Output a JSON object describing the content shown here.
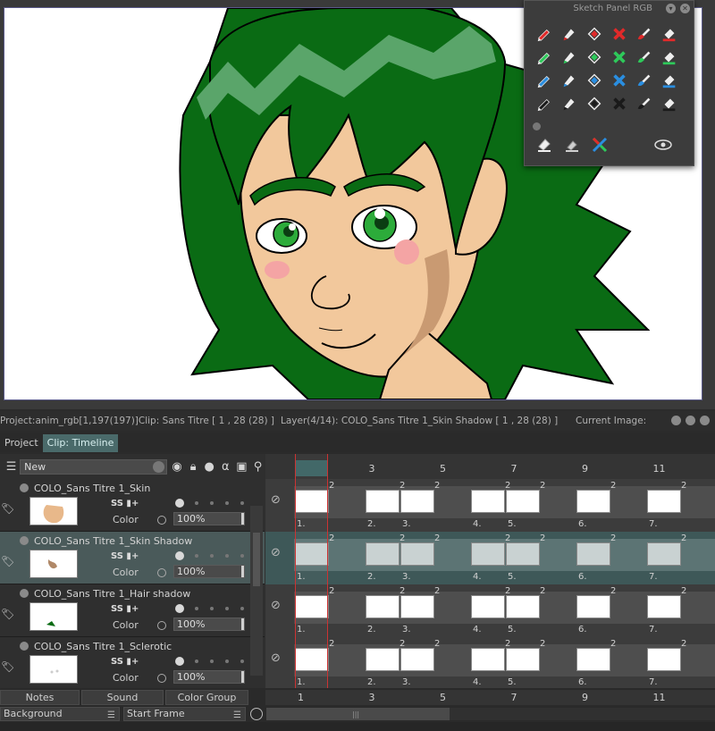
{
  "sketch_panel": {
    "title": "Sketch Panel RGB",
    "menu_glyph": "▾",
    "close_glyph": "✕",
    "colors": {
      "red": "#e02a2a",
      "green": "#2ec95a",
      "blue": "#2a8ee0",
      "black": "#1a1a1a"
    }
  },
  "info_bar": {
    "project": "Project:anim_rgb[1,197(197)]Clip: Sans Titre [ 1 , 28  (28) ]",
    "layer": "Layer(4/14): COLO_Sans Titre 1_Skin Shadow [ 1 , 28  (28) ]",
    "current_image": "Current Image: "
  },
  "tabs": [
    {
      "label": "Project"
    },
    {
      "label": "Clip: Timeline"
    }
  ],
  "layer_toolbar": {
    "new_label": "New"
  },
  "layers": [
    {
      "name": "COLO_Sans Titre 1_Skin",
      "color_label": "Color",
      "opacity": "100%"
    },
    {
      "name": "COLO_Sans Titre 1_Skin Shadow",
      "color_label": "Color",
      "opacity": "100%"
    },
    {
      "name": "COLO_Sans Titre 1_Hair shadow",
      "color_label": "Color",
      "opacity": "100%"
    },
    {
      "name": "COLO_Sans Titre 1_Sclerotic",
      "color_label": "Color",
      "opacity": "100%"
    }
  ],
  "layer_buttons": "SS ▮+",
  "ruler": [
    "1",
    "3",
    "5",
    "7",
    "9",
    "11"
  ],
  "cel_numbers": [
    "1.",
    "2.",
    "3.",
    "4.",
    "5.",
    "6.",
    "7."
  ],
  "cel_duration": "2",
  "bottom_tabs": [
    "Notes",
    "Sound",
    "Color Group"
  ],
  "bottom_bar": {
    "background": "Background",
    "start_frame": "Start Frame"
  }
}
